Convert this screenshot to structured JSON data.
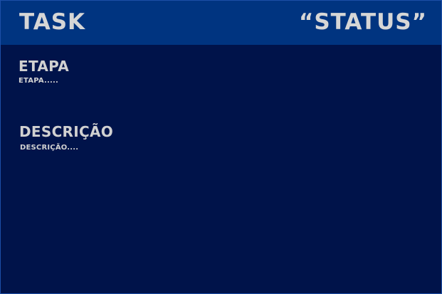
{
  "header": {
    "task_label": "TASK",
    "status_label": "“STATUS”"
  },
  "etapa": {
    "label": "ETAPA",
    "value": "ETAPA....."
  },
  "descricao": {
    "label": "DESCRIÇÃO",
    "value": "DESCRIÇÃO...."
  },
  "colors": {
    "background": "#00134a",
    "header": "#003480",
    "text": "#d6d6d6"
  }
}
